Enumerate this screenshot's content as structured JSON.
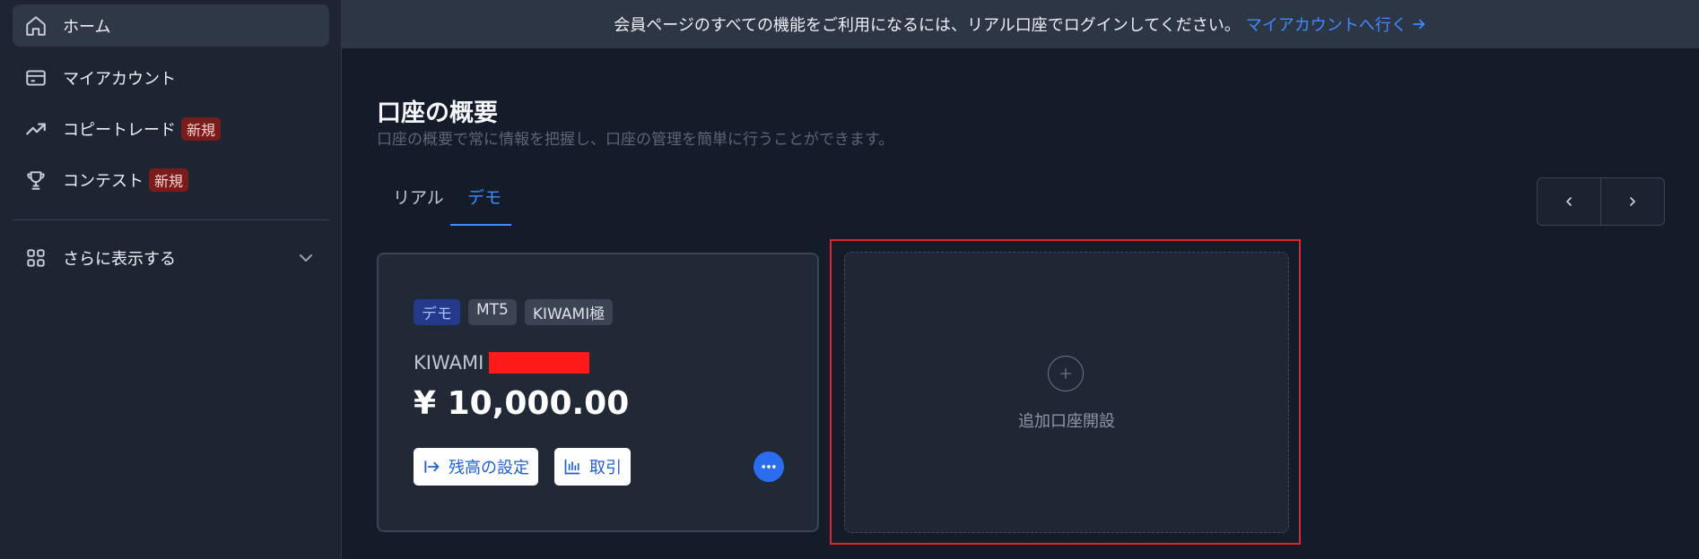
{
  "sidebar": {
    "items": [
      {
        "label": "ホーム",
        "icon": "home-icon"
      },
      {
        "label": "マイアカウント",
        "icon": "card-icon"
      },
      {
        "label": "コピートレード",
        "icon": "trending-up-icon",
        "badge": "新規"
      },
      {
        "label": "コンテスト",
        "icon": "trophy-icon",
        "badge": "新規"
      }
    ],
    "more": {
      "label": "さらに表示する",
      "icon": "grid-icon"
    }
  },
  "banner": {
    "text": "会員ページのすべての機能をご利用になるには、リアル口座でログインしてください。",
    "link_label": "マイアカウントへ行く"
  },
  "page": {
    "title": "口座の概要",
    "subtitle": "口座の概要で常に情報を把握し、口座の管理を簡単に行うことができます。"
  },
  "tabs": [
    {
      "label": "リアル",
      "active": false
    },
    {
      "label": "デモ",
      "active": true
    }
  ],
  "account_card": {
    "tags": [
      "デモ",
      "MT5",
      "KIWAMI極"
    ],
    "name": "KIWAMI",
    "balance": "¥ 10,000.00",
    "actions": [
      {
        "label": "残高の設定",
        "icon": "set-balance-icon"
      },
      {
        "label": "取引",
        "icon": "chart-icon"
      }
    ]
  },
  "add_account": {
    "label": "追加口座開設",
    "icon": "plus-icon"
  },
  "colors": {
    "accent": "#3f8cff",
    "badge_new_bg": "#7a1c1c",
    "highlight": "#e0262b",
    "redaction": "#ff1a1a"
  }
}
